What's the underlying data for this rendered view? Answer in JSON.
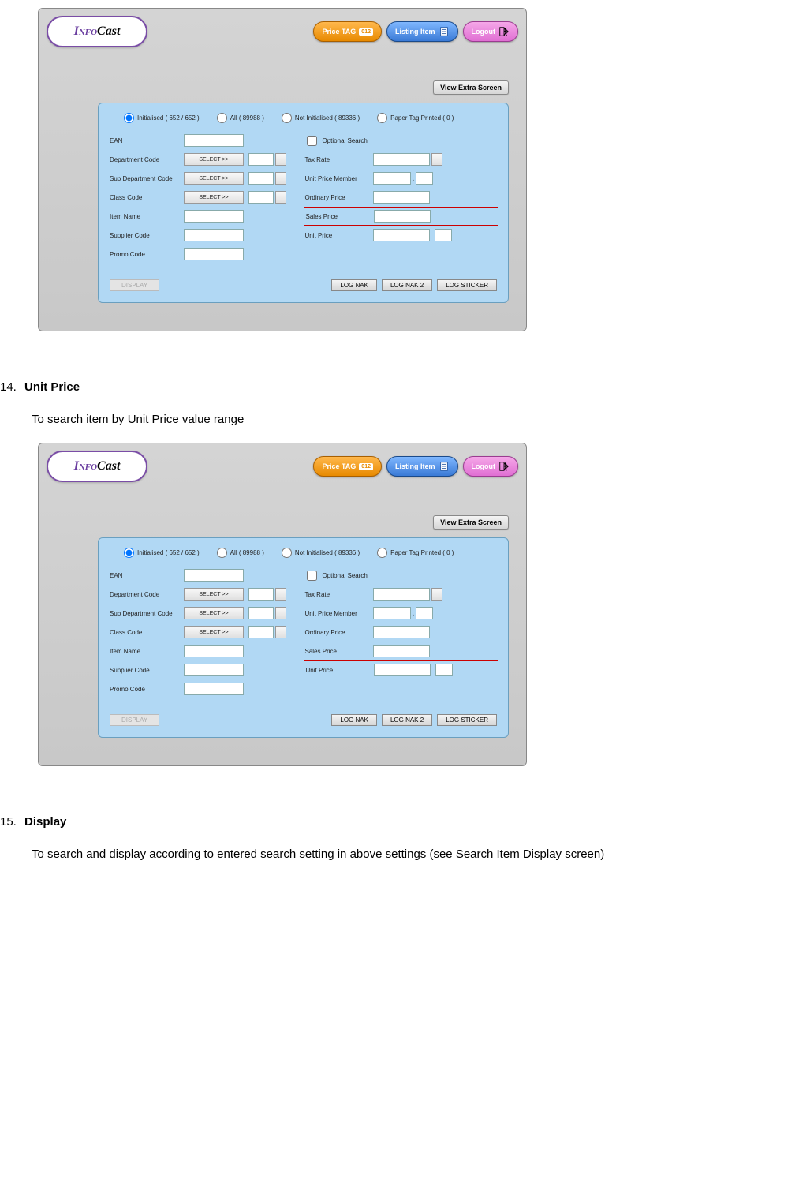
{
  "logo": {
    "part1": "Info",
    "part2": "Cast"
  },
  "header_buttons": {
    "price_tag": "Price TAG",
    "price_tag_badge": "012",
    "listing_item": "Listing Item",
    "logout": "Logout"
  },
  "view_extra": "View Extra Screen",
  "radios": {
    "initialised": "Initialised  ( 652 / 652 )",
    "all": "All  ( 89988 )",
    "not_initialised": "Not Initialised  ( 89336 )",
    "paper_tag": "Paper Tag Printed  ( 0 )"
  },
  "labels_left": {
    "ean": "EAN",
    "dept": "Department Code",
    "subdept": "Sub Department Code",
    "classcode": "Class Code",
    "itemname": "Item Name",
    "supplier": "Supplier Code",
    "promo": "Promo Code"
  },
  "labels_right": {
    "optional": "Optional Search",
    "taxrate": "Tax Rate",
    "upm": "Unit Price Member",
    "ordprice": "Ordinary Price",
    "salesprice": "Sales Price",
    "unitprice": "Unit Price"
  },
  "select_label": "SELECT >>",
  "buttons": {
    "display": "DISPLAY",
    "lognak": "LOG NAK",
    "lognak2": "LOG NAK 2",
    "logsticker": "LOG STICKER"
  },
  "sections": {
    "s14_num": "14.",
    "s14_title": "Unit Price",
    "s14_desc": "To search item by Unit Price value range",
    "s15_num": "15.",
    "s15_title": "Display",
    "s15_desc": "To search and display according to entered search setting in above settings (see Search Item Display screen)"
  }
}
